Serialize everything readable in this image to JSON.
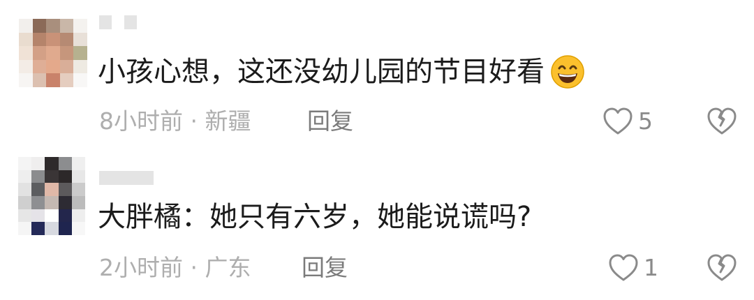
{
  "comments": [
    {
      "text": "小孩心想，这还没幼儿园的节目好看",
      "emoji": "grinning-face-emoji",
      "time": "8小时前",
      "separator": "·",
      "location": "新疆",
      "reply_label": "回复",
      "likes": "5"
    },
    {
      "text": "大胖橘：她只有六岁，她能说谎吗?",
      "time": "2小时前",
      "separator": "·",
      "location": "广东",
      "reply_label": "回复",
      "likes": "1"
    }
  ],
  "icons": {
    "like": "heart-outline-icon",
    "dislike": "broken-heart-icon"
  },
  "colors": {
    "text": "#1b1b1b",
    "meta": "#aeaeae",
    "reply": "#7b7b7b",
    "icon": "#8a8a8a"
  }
}
